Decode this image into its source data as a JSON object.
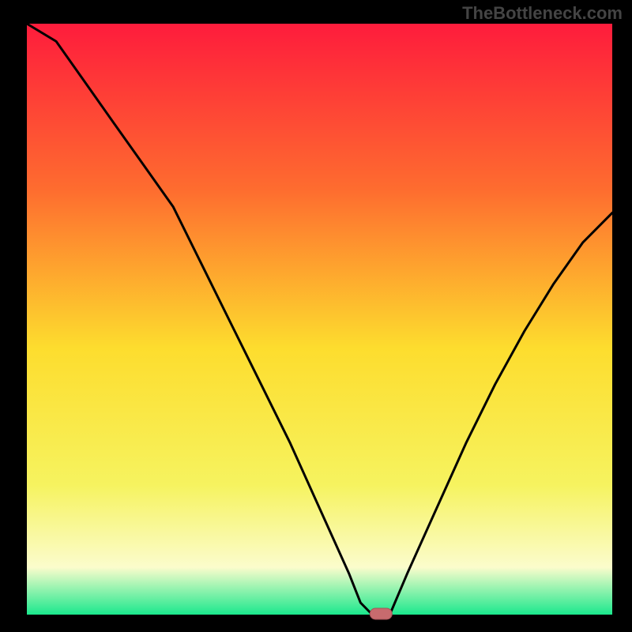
{
  "watermark": "TheBottleneck.com",
  "colors": {
    "background": "#000000",
    "curve_stroke": "#000000",
    "marker_fill": "#c76b6e",
    "marker_stroke": "#a65257",
    "gradient_top": "#fe1c3c",
    "gradient_mid1": "#fe8b2c",
    "gradient_mid2": "#fddd2e",
    "gradient_pale": "#fbfccc",
    "gradient_bottom": "#1be88d"
  },
  "chart_data": {
    "type": "line",
    "title": "",
    "xlabel": "",
    "ylabel": "",
    "xlim": [
      0,
      100
    ],
    "ylim": [
      0,
      100
    ],
    "x": [
      0,
      5,
      10,
      15,
      20,
      25,
      30,
      35,
      40,
      45,
      50,
      55,
      57,
      59,
      62,
      65,
      70,
      75,
      80,
      85,
      90,
      95,
      100
    ],
    "y": [
      104,
      97,
      90,
      83,
      76,
      69,
      59,
      49,
      39,
      29,
      18,
      7,
      2,
      0,
      0,
      7,
      18,
      29,
      39,
      48,
      56,
      63,
      68
    ],
    "marker": {
      "x": 60.5,
      "y": 0
    },
    "notes": "V-shaped bottleneck curve on vertical red→green gradient; minimum near x≈60. Axes unlabeled."
  }
}
